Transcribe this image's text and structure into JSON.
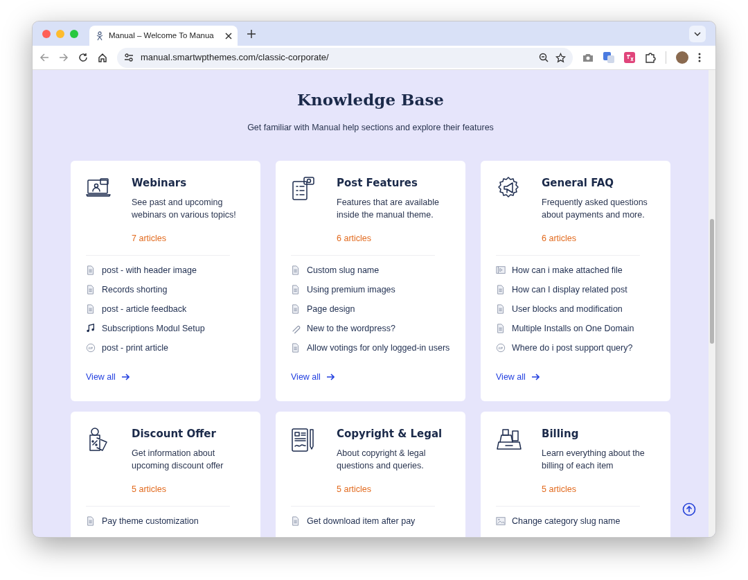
{
  "browser": {
    "tab": {
      "title": "Manual – Welcome To Manua"
    },
    "address_bar": {
      "url": "manual.smartwpthemes.com/classic-corporate/"
    }
  },
  "page": {
    "title": "Knowledge Base",
    "subtitle": "Get familiar with Manual help sections and explore their features"
  },
  "categories": [
    {
      "title": "Webinars",
      "description": "See past and upcoming webinars on various topics!",
      "count": "7 articles",
      "articles": [
        {
          "kind": "document",
          "title": "post - with header image"
        },
        {
          "kind": "document",
          "title": "Records shorting"
        },
        {
          "kind": "document",
          "title": "post - article feedback"
        },
        {
          "kind": "music",
          "title": "Subscriptions Modul Setup"
        },
        {
          "kind": "quote",
          "title": "post - print article"
        }
      ],
      "view_all": "View all"
    },
    {
      "title": "Post Features",
      "description": "Features that are available inside the manual theme.",
      "count": "6 articles",
      "articles": [
        {
          "kind": "document",
          "title": "Custom slug name"
        },
        {
          "kind": "document",
          "title": "Using premium images"
        },
        {
          "kind": "document",
          "title": "Page design"
        },
        {
          "kind": "link",
          "title": "New to the wordpress?"
        },
        {
          "kind": "document",
          "title": "Allow votings for only logged-in users"
        }
      ],
      "view_all": "View all"
    },
    {
      "title": "General FAQ",
      "description": "Frequently asked questions about payments and more.",
      "count": "6 articles",
      "articles": [
        {
          "kind": "video",
          "title": "How can i make attached file"
        },
        {
          "kind": "document",
          "title": "How can I display related post"
        },
        {
          "kind": "document",
          "title": "User blocks and modification"
        },
        {
          "kind": "document",
          "title": "Multiple Installs on One Domain"
        },
        {
          "kind": "quote",
          "title": "Where do i post support query?"
        }
      ],
      "view_all": "View all"
    },
    {
      "title": "Discount Offer",
      "description": "Get information about upcoming discount offer",
      "count": "5 articles",
      "articles": [
        {
          "kind": "document",
          "title": "Pay theme customization"
        }
      ]
    },
    {
      "title": "Copyright & Legal",
      "description": "About copyright & legal questions and queries.",
      "count": "5 articles",
      "articles": [
        {
          "kind": "document",
          "title": "Get download item after pay"
        }
      ]
    },
    {
      "title": "Billing",
      "description": "Learn everything about the billing of each item",
      "count": "5 articles",
      "articles": [
        {
          "kind": "image",
          "title": "Change category slug name"
        }
      ]
    }
  ]
}
